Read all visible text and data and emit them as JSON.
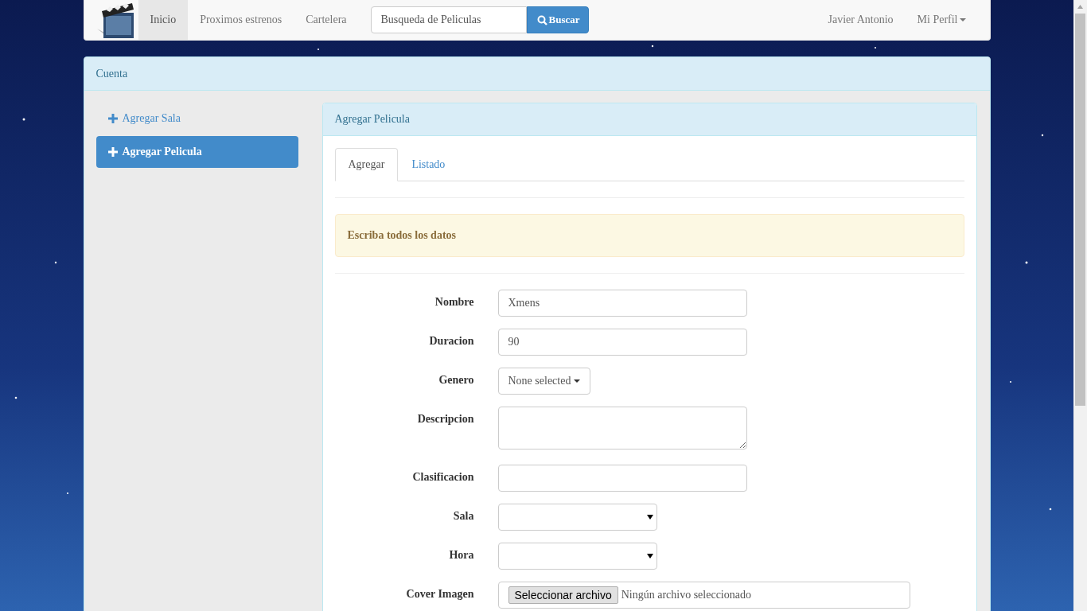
{
  "navbar": {
    "links": [
      {
        "label": "Inicio",
        "selected": true
      },
      {
        "label": "Proximos estrenos",
        "selected": false
      },
      {
        "label": "Cartelera",
        "selected": false
      }
    ],
    "search": {
      "placeholder": "Busqueda de Peliculas",
      "button": "Buscar"
    },
    "user": "Javier Antonio",
    "profile_menu": "Mi Perfil"
  },
  "account_panel": {
    "title": "Cuenta",
    "sidebar": {
      "items": [
        {
          "label": "Agregar Sala",
          "selected": false
        },
        {
          "label": "Agregar Pelicula",
          "selected": true
        }
      ]
    },
    "form_panel": {
      "title": "Agregar Pelicula",
      "tabs": [
        {
          "label": "Agregar",
          "selected": true
        },
        {
          "label": "Listado",
          "selected": false
        }
      ],
      "alert": "Escriba todos los datos",
      "fields": [
        {
          "label": "Nombre",
          "kind": "text",
          "value": "Xmens"
        },
        {
          "label": "Duracion",
          "kind": "text",
          "value": "90"
        },
        {
          "label": "Genero",
          "kind": "dropdown",
          "value": "None selected"
        },
        {
          "label": "Descripcion",
          "kind": "textarea"
        },
        {
          "label": "Clasificacion",
          "kind": "text"
        },
        {
          "label": "Sala",
          "kind": "select"
        },
        {
          "label": "Hora",
          "kind": "select"
        },
        {
          "label": "Cover Imagen",
          "kind": "file",
          "button": "Seleccionar archivo",
          "status": "Ningún archivo seleccionado"
        }
      ]
    }
  }
}
